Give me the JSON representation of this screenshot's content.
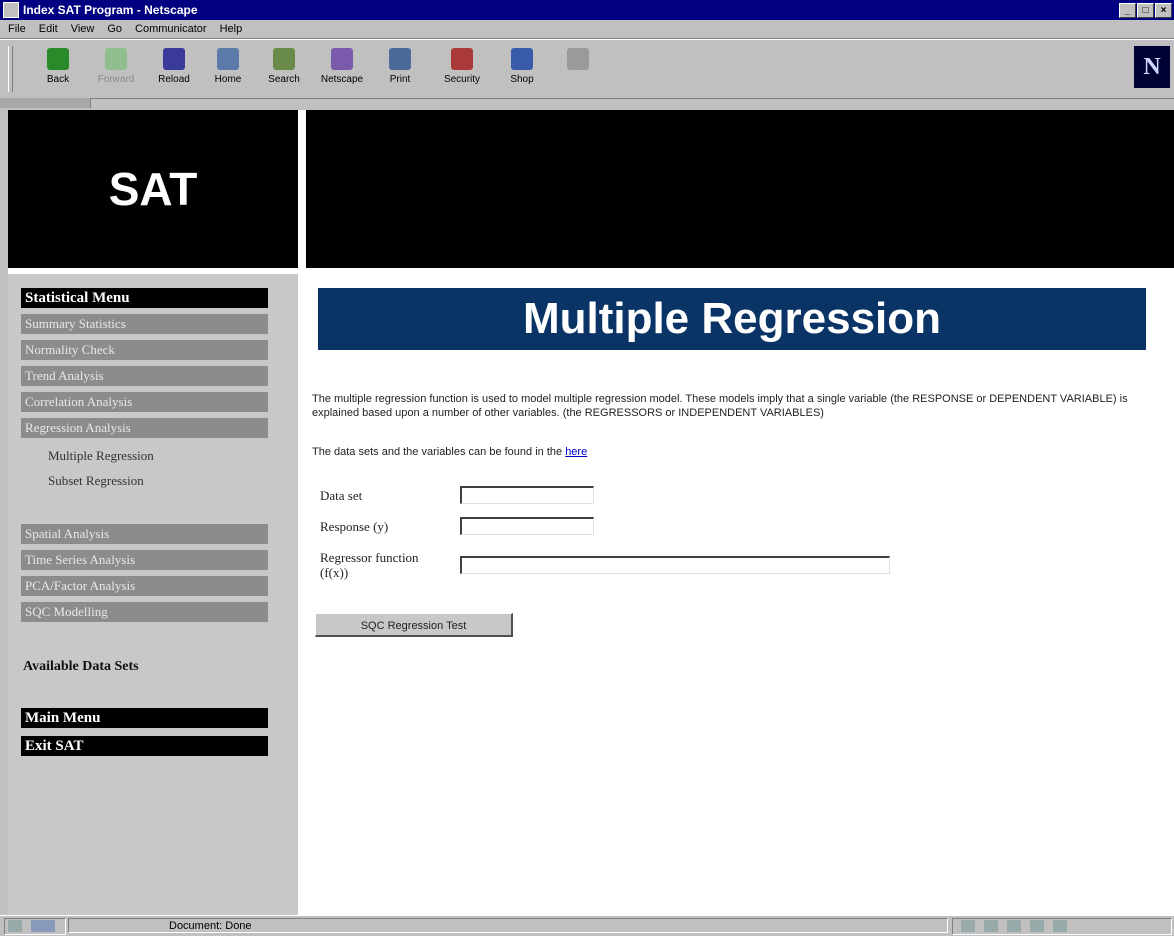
{
  "window": {
    "title": "Index SAT Program - Netscape",
    "buttons": [
      "_",
      "□",
      "×"
    ]
  },
  "menubar": [
    "File",
    "Edit",
    "View",
    "Go",
    "Communicator",
    "Help"
  ],
  "toolbar": {
    "buttons": [
      {
        "label": "Back",
        "icon": "back-arrow-icon",
        "color": "#2a8a2a"
      },
      {
        "label": "Forward",
        "icon": "forward-arrow-icon",
        "color": "#8fbf8f"
      },
      {
        "label": "Reload",
        "icon": "reload-icon",
        "color": "#3a3a9a"
      },
      {
        "label": "Home",
        "icon": "home-icon",
        "color": "#5a7aaa"
      },
      {
        "label": "Search",
        "icon": "search-icon",
        "color": "#6a8a4a"
      },
      {
        "label": "Netscape",
        "icon": "netscape-icon",
        "color": "#7a5aaa"
      },
      {
        "label": "Print",
        "icon": "print-icon",
        "color": "#4a6a9a"
      },
      {
        "label": "Security",
        "icon": "security-icon",
        "color": "#aa3a3a"
      },
      {
        "label": "Shop",
        "icon": "shop-icon",
        "color": "#3a5aaa"
      },
      {
        "label": "",
        "icon": "stop-icon",
        "color": "#9a9a9a"
      }
    ],
    "brand": "N"
  },
  "logo": "SAT",
  "sidebar": {
    "header": "Statistical Menu",
    "items": [
      "Summary Statistics",
      "Normality Check",
      "Trend Analysis",
      "Correlation Analysis",
      "Regression Analysis"
    ],
    "subitems": [
      "Multiple Regression",
      "Subset Regression"
    ],
    "items2": [
      "Spatial Analysis",
      "Time Series Analysis",
      "PCA/Factor Analysis",
      "SQC Modelling"
    ],
    "datasets": "Available Data Sets",
    "main_menu": "Main Menu",
    "exit": "Exit SAT"
  },
  "main": {
    "title": "Multiple Regression",
    "description": "The multiple regression function is used to model multiple regression model. These models imply that a single variable (the RESPONSE or DEPENDENT VARIABLE) is explained based upon a number of other variables. (the REGRESSORS or INDEPENDENT VARIABLES)",
    "datasets_text": "The data sets and the variables can be found in the",
    "datasets_link": "here",
    "fields": {
      "dataset_label": "Data set",
      "response_label": "Response (y)",
      "regressor_label_1": "Regressor function",
      "regressor_label_2": "(f(x))",
      "dataset_value": "",
      "response_value": "",
      "regressor_value": ""
    },
    "submit": "SQC Regression Test"
  },
  "status": {
    "text": "Document: Done"
  }
}
